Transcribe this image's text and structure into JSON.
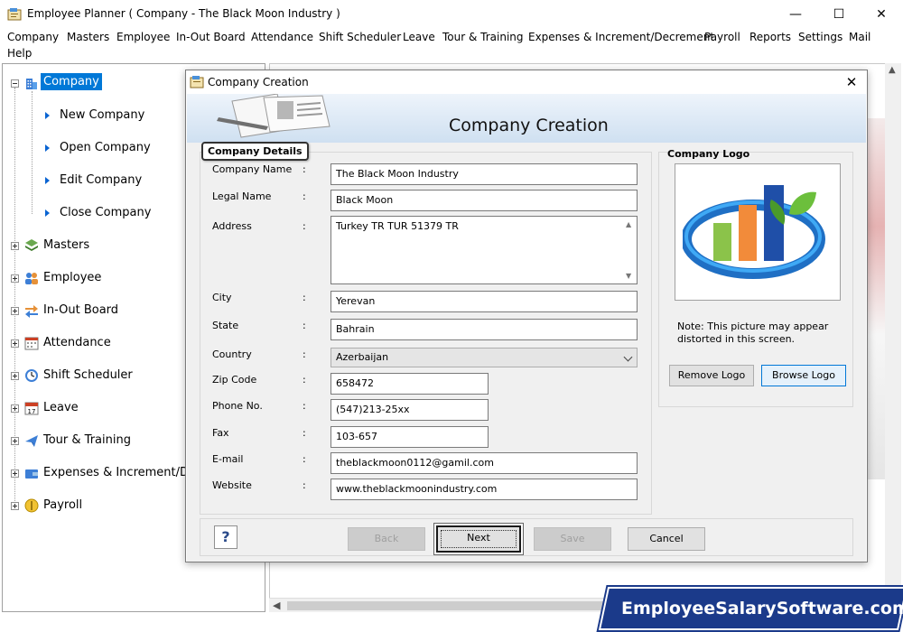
{
  "window": {
    "title": "Employee Planner ( Company - The Black Moon Industry )",
    "minimize": "—",
    "maximize": "☐",
    "close": "✕"
  },
  "menu": [
    "Company",
    "Masters",
    "Employee",
    "In-Out Board",
    "Attendance",
    "Shift Scheduler",
    "Leave",
    "Tour & Training",
    "Expenses & Increment/Decrement",
    "Payroll",
    "Reports",
    "Settings",
    "Mail",
    "Help"
  ],
  "tree": {
    "root": "Company",
    "company_children": [
      "New Company",
      "Open Company",
      "Edit Company",
      "Close Company"
    ],
    "nodes": [
      "Masters",
      "Employee",
      "In-Out Board",
      "Attendance",
      "Shift Scheduler",
      "Leave",
      "Tour & Training",
      "Expenses & Increment/D",
      "Payroll"
    ],
    "calendar_icon_number": "17"
  },
  "dialog": {
    "title": "Company Creation",
    "close": "✕",
    "header_title": "Company Creation",
    "details_group": "Company Details",
    "fields": {
      "company_name": {
        "label": "Company Name",
        "value": "The Black Moon Industry"
      },
      "legal_name": {
        "label": "Legal Name",
        "value": "Black Moon"
      },
      "address": {
        "label": "Address",
        "value": "Turkey TR TUR 51379 TR"
      },
      "city": {
        "label": "City",
        "value": "Yerevan"
      },
      "state": {
        "label": "State",
        "value": "Bahrain"
      },
      "country": {
        "label": "Country",
        "value": "Azerbaijan"
      },
      "zip": {
        "label": "Zip Code",
        "value": "658472"
      },
      "phone": {
        "label": "Phone No.",
        "value": "(547)213-25xx"
      },
      "fax": {
        "label": "Fax",
        "value": "103-657"
      },
      "email": {
        "label": "E-mail",
        "value": "theblackmoon0112@gamil.com"
      },
      "website": {
        "label": "Website",
        "value": "www.theblackmoonindustry.com"
      }
    },
    "colon": ":",
    "logo": {
      "title": "Company Logo",
      "note": "Note: This picture may appear distorted in this screen.",
      "remove": "Remove Logo",
      "browse": "Browse Logo"
    },
    "buttons": {
      "help": "?",
      "back": "Back",
      "next": "Next",
      "save": "Save",
      "cancel": "Cancel"
    }
  },
  "watermark": "EmployeeSalarySoftware.com",
  "colors": {
    "selection": "#0078d7",
    "watermark_bg": "#1b3a8a",
    "header_gradient_top": "#eef4fb",
    "header_gradient_bottom": "#cfe0f1"
  }
}
